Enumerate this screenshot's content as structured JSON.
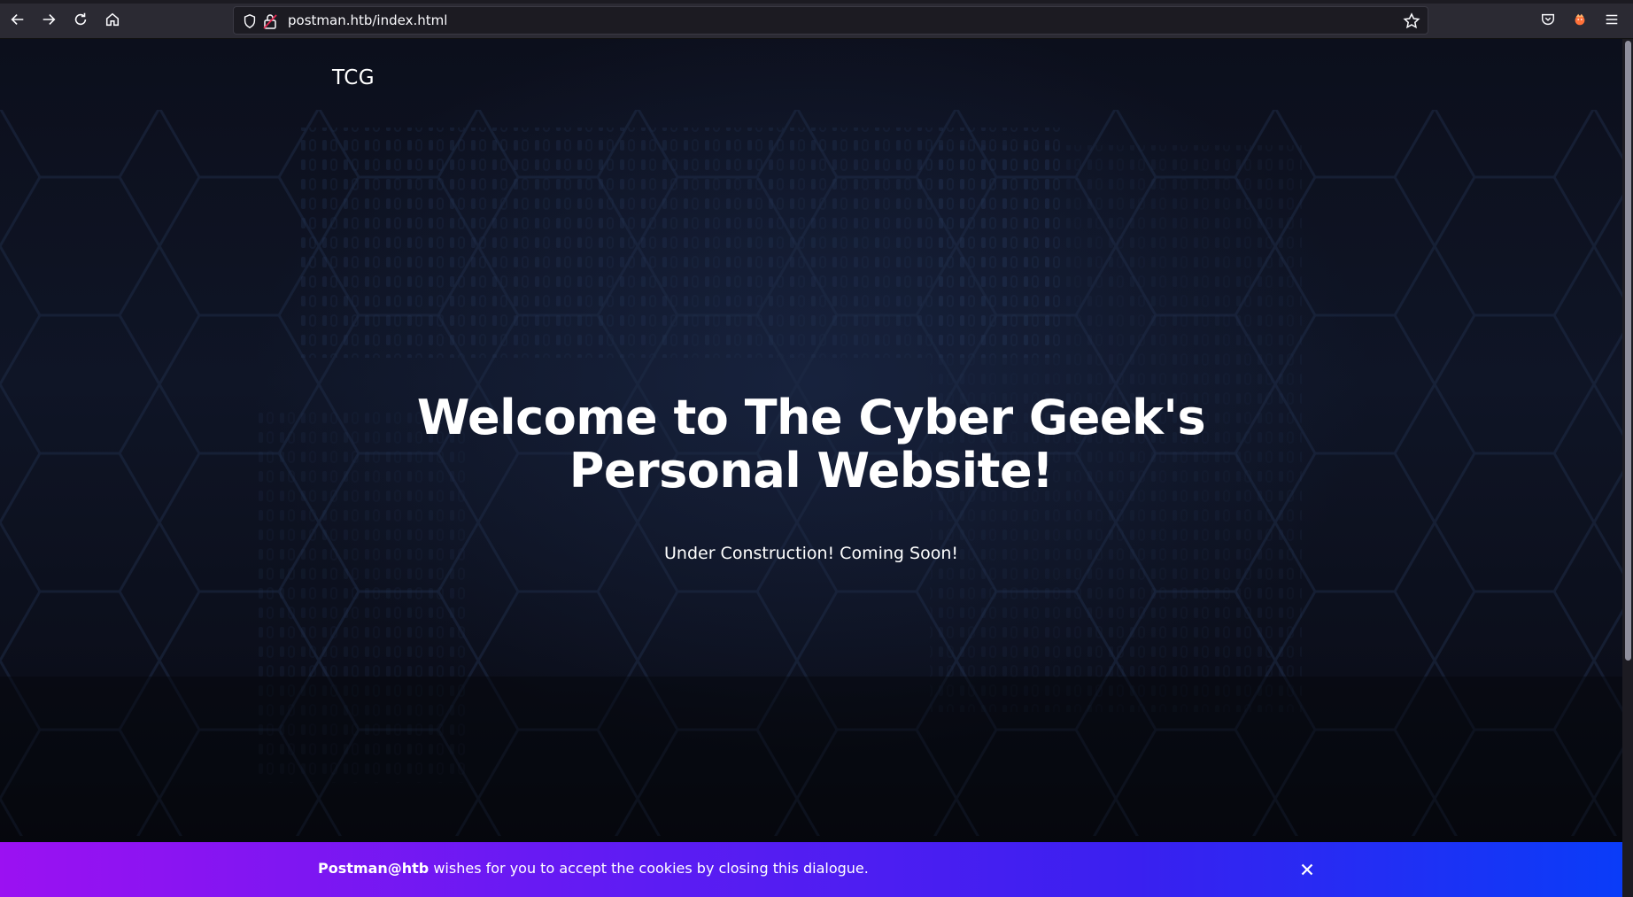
{
  "browser": {
    "url": "postman.htb/index.html",
    "icons": [
      "back-icon",
      "forward-icon",
      "reload-icon",
      "home-icon",
      "shield-icon",
      "lock-icon",
      "bookmark-star-icon",
      "pocket-icon",
      "extension-icon",
      "menu-icon"
    ]
  },
  "site": {
    "brand": "TCG",
    "hero_title_line1": "Welcome to The Cyber Geek's",
    "hero_title_line2": "Personal Website!",
    "hero_subtitle": "Under Construction! Coming Soon!"
  },
  "cookie_banner": {
    "strong": "Postman@htb",
    "text": " wishes for you to accept the cookies by closing this dialogue."
  },
  "colors": {
    "chrome_bg": "#2b2a33",
    "page_bg": "#0b0d16",
    "banner_start": "#9b11f2",
    "banner_end": "#0a3cf8"
  }
}
